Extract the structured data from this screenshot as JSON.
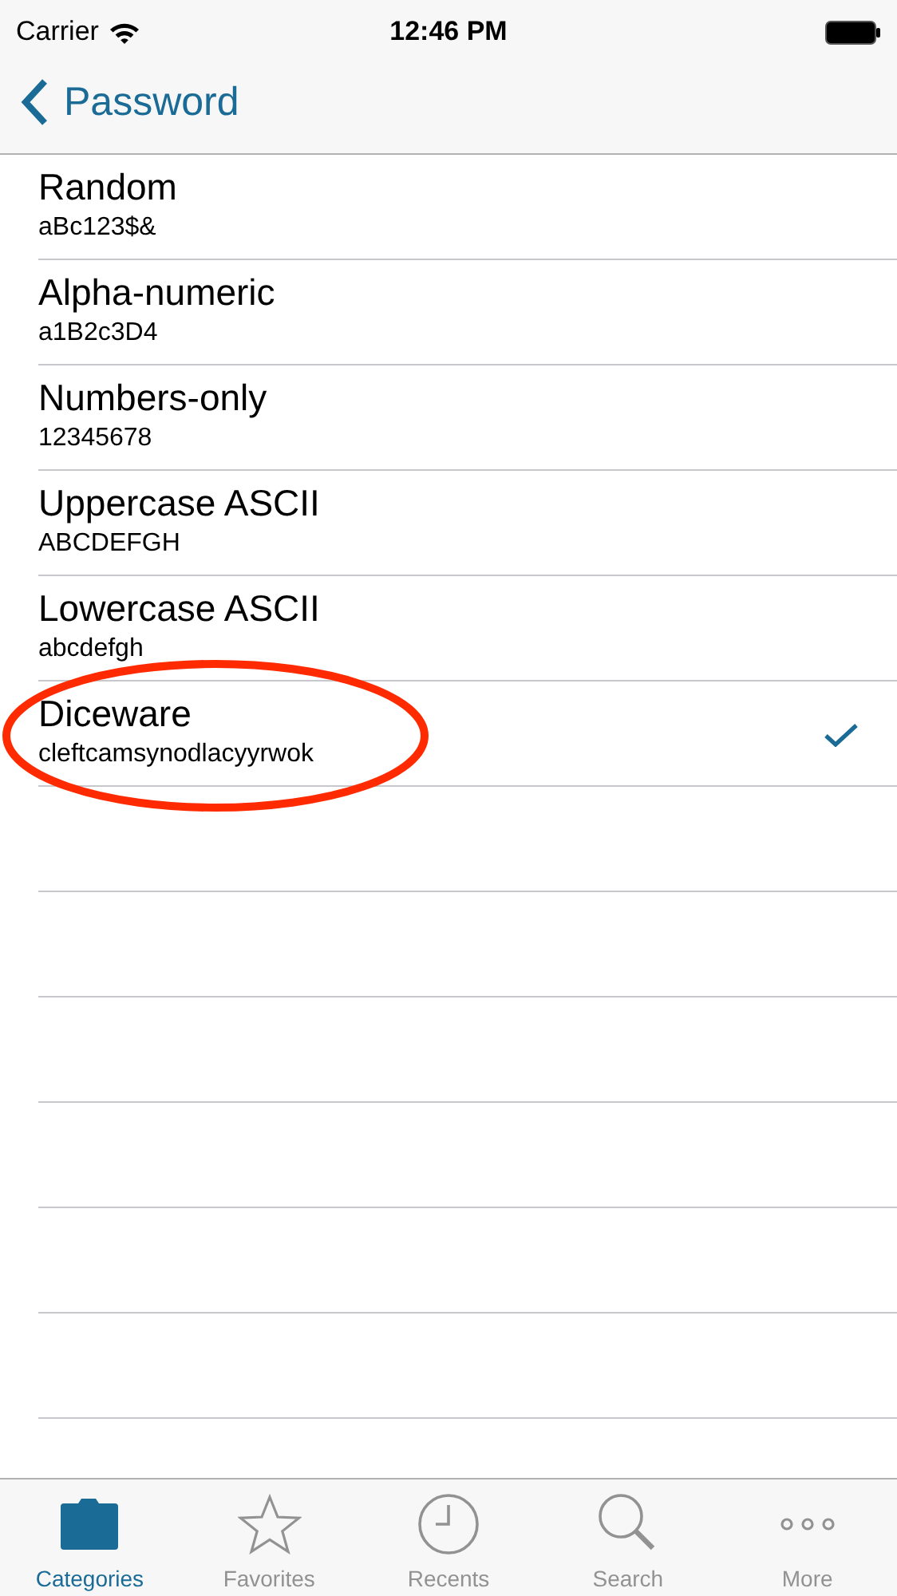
{
  "status_bar": {
    "carrier": "Carrier",
    "time": "12:46 PM"
  },
  "nav_bar": {
    "back_label": "Password"
  },
  "options": [
    {
      "title": "Random",
      "example": "aBc123$&",
      "selected": false,
      "circled": false
    },
    {
      "title": "Alpha-numeric",
      "example": "a1B2c3D4",
      "selected": false,
      "circled": false
    },
    {
      "title": "Numbers-only",
      "example": "12345678",
      "selected": false,
      "circled": false
    },
    {
      "title": "Uppercase ASCII",
      "example": "ABCDEFGH",
      "selected": false,
      "circled": false
    },
    {
      "title": "Lowercase ASCII",
      "example": "abcdefgh",
      "selected": false,
      "circled": false
    },
    {
      "title": "Diceware",
      "example": "cleftcamsynodlacyyrwok",
      "selected": true,
      "circled": true
    }
  ],
  "tab_bar": [
    {
      "label": "Categories",
      "kind": "folder",
      "selected": true
    },
    {
      "label": "Favorites",
      "kind": "star",
      "selected": false
    },
    {
      "label": "Recents",
      "kind": "clock",
      "selected": false
    },
    {
      "label": "Search",
      "kind": "search",
      "selected": false
    },
    {
      "label": "More",
      "kind": "more",
      "selected": false
    }
  ]
}
